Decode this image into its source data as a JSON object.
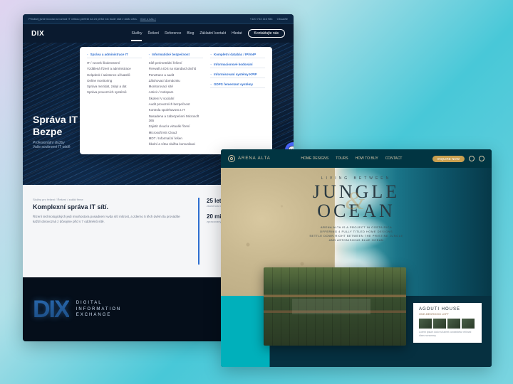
{
  "dix": {
    "topbar": {
      "left": "Přinášej jsme inovaci a rozhod IT velkou perfekt na 24 příští rok bude stát v další cifra.",
      "link": "Více o nás >",
      "phone": "+420 733 116 984",
      "lang": "Obsaďte"
    },
    "logo": "DIX",
    "nav": [
      "Služby",
      "Řešení",
      "Reference",
      "Blog",
      "Základní kontakt",
      "Hledat"
    ],
    "cta": "Kontaktujte nás",
    "mega": {
      "col1_head": "Správa a administrace IT",
      "col1_items": [
        "IT / vzorek školensterní",
        "Vzdálená řízení a administrace",
        "Helpdesk / asistence uživatelů",
        "Online monitoring",
        "Správa mezidat, zabyl a dat",
        "Správa provozních systémů"
      ],
      "col2_head": "Informatické bezpečnost",
      "col2_items": [
        "Sítě perimetrální řešení",
        "Firewall a IDS na standard obchů",
        "Penetrace a audit",
        "Zálohovací domácnku",
        "Monitorovací sítě",
        "Antivir / Antispam",
        "Školení V sociální",
        "Audit provozních bezpečnost",
        "Kontrola spolehavost a IT",
        "Nasadena a zabezpečení Microsoft 365",
        "Zajistit cloud a virtualik řízení",
        "Microsoft MS Cloud",
        "MDT / Informační řešen",
        "Školní a vítna služba komunikaci"
      ],
      "col3_links": [
        "Kompletní databác / IP/VoIP",
        "Informacionové kodování",
        "Informisovaní systémy KPIP",
        "GDPS řementant systémy"
      ]
    },
    "hero": {
      "title": "Správa IT\nBezpe",
      "subtitle": "Profesionální služby\nVaše soukromé IT oddě"
    },
    "body": {
      "crumb": "Služby pro řešení / Řešení / zaklid firme",
      "title": "Komplexní správa IT sítí.",
      "text": "Řízení technologických jedi mnohostora posadnení vvda sítí mítrost, a zderno 5 těch dvěm tla provádíte každí obrovozná z důvojme příd s 7 oddměnů sítě."
    },
    "stats": [
      {
        "num": "25 let",
        "label": "zkušenost rozhodku\nna trhu"
      },
      {
        "num": "20 mil.",
        "label": "zpracovaných uplatné\nprosti řichky a zc"
      }
    ],
    "footer": {
      "big": "DIX",
      "tag": "DIGITAL\nINFORMATION\nEXCHANGE"
    }
  },
  "arena": {
    "logo": "ARENA ALTA",
    "nav": [
      "HOME DESIGNS",
      "TOURS",
      "HOW TO BUY",
      "CONTACT"
    ],
    "cta": "INQUIRE NOW",
    "hero": {
      "overline": "LIVING BETWEEN",
      "line1": "JUNGLE",
      "line2": "OCEAN",
      "amp": "&",
      "desc": "ARENA ALTA IS A PROJECT IN COSTA RICA\nOFFERING 4 FULLY TITLED HOME DESIGNS\nSETTLE DOWN RIGHT BETWEEN THE PRISTINE JUNGLE\nAND ASTONISHING BLUE OCEAN"
    },
    "card": {
      "title": "AGOUTI HOUSE",
      "sub": "ONE-BEDROOM LOFT",
      "text": "Lorem ipsum dolor sit amet consectetur elit sed diam nonummy"
    }
  }
}
